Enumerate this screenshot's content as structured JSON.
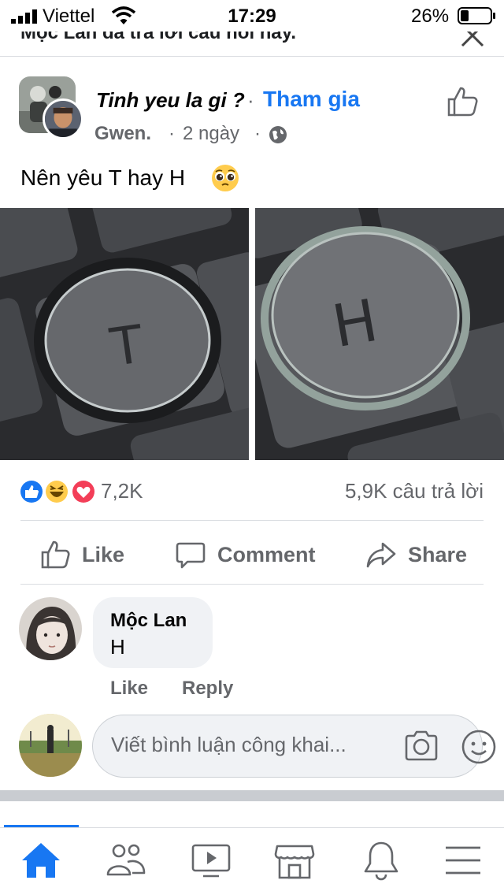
{
  "status_bar": {
    "carrier": "Viettel",
    "time": "17:29",
    "battery_percent": "26%"
  },
  "header": {
    "cut_text": "Mộc Lan đã trả lời câu hỏi này."
  },
  "post": {
    "group_name": "Tinh yeu la gi ?",
    "separator": "·",
    "join_label": "Tham gia",
    "author": "Gwen.",
    "time": "2 ngày",
    "text": "Nên yêu T hay H",
    "photo_left_letter": "T",
    "photo_right_letter": "H",
    "reaction_count": "7,2K",
    "answer_count": "5,9K câu trả lời"
  },
  "actions": {
    "like": "Like",
    "comment": "Comment",
    "share": "Share"
  },
  "comment": {
    "author": "Mộc Lan",
    "text": "H",
    "like": "Like",
    "reply": "Reply"
  },
  "composer": {
    "placeholder": "Viết bình luận công khai..."
  },
  "colors": {
    "accent": "#1877f2",
    "muted_text": "#65676b",
    "bubble": "#f0f2f5"
  },
  "tab_bar": {
    "icons": [
      "home-icon",
      "friends-icon",
      "watch-icon",
      "marketplace-icon",
      "notifications-icon",
      "menu-icon"
    ],
    "active": "home-icon"
  }
}
